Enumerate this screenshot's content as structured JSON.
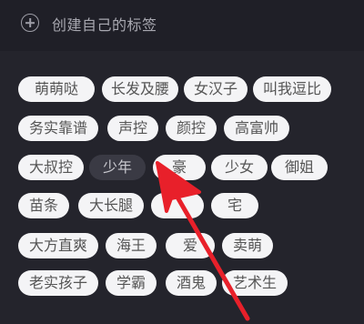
{
  "header": {
    "create_label": "创建自己的标签"
  },
  "tags": [
    {
      "label": "萌萌哒"
    },
    {
      "label": "长发及腰"
    },
    {
      "label": "女汉子"
    },
    {
      "label": "叫我逗比"
    },
    {
      "label": "务实靠谱"
    },
    {
      "label": "声控"
    },
    {
      "label": "颜控"
    },
    {
      "label": "高富帅"
    },
    {
      "label": "大叔控"
    },
    {
      "label": "少年"
    },
    {
      "label": "豪"
    },
    {
      "label": "少女"
    },
    {
      "label": "御姐"
    },
    {
      "label": "苗条"
    },
    {
      "label": "大长腿"
    },
    {
      "label": ""
    },
    {
      "label": "宅"
    },
    {
      "label": "大方直爽"
    },
    {
      "label": "海王"
    },
    {
      "label": "爱"
    },
    {
      "label": "卖萌"
    },
    {
      "label": "老实孩子"
    },
    {
      "label": "学霸"
    },
    {
      "label": "酒鬼"
    },
    {
      "label": "艺术生"
    }
  ],
  "colors": {
    "background": "#24242c",
    "chip": "#f4f4f6",
    "chip_selected": "#3a3a44",
    "arrow": "#e8202a"
  }
}
